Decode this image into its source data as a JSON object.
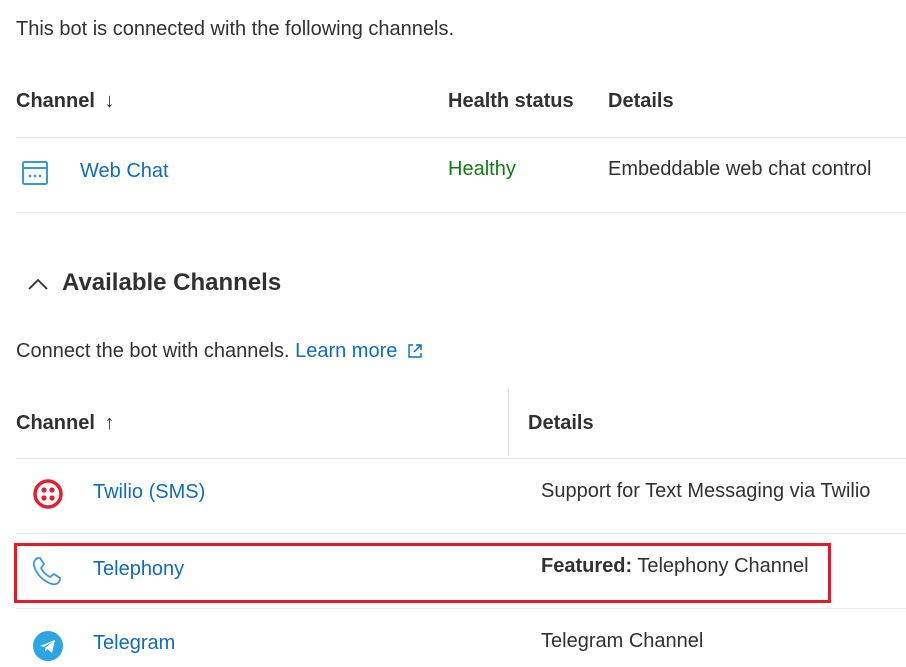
{
  "connected": {
    "intro": "This bot is connected with the following channels.",
    "columns": {
      "channel": "Channel",
      "channel_sort_icon": "↓",
      "health": "Health status",
      "details": "Details"
    },
    "rows": [
      {
        "icon": "web-chat-icon",
        "name": "Web Chat",
        "health": "Healthy",
        "details": "Embeddable web chat control"
      }
    ]
  },
  "available": {
    "title": "Available Channels",
    "collapse_icon": "chevron-up-icon",
    "intro": "Connect the bot with channels.",
    "learn_more": "Learn more",
    "columns": {
      "channel": "Channel",
      "channel_sort_icon": "↑",
      "details": "Details"
    },
    "rows": [
      {
        "icon": "twilio-icon",
        "name": "Twilio (SMS)",
        "details_bold": "",
        "details": "Support for Text Messaging via Twilio"
      },
      {
        "icon": "phone-icon",
        "name": "Telephony",
        "details_bold": "Featured:",
        "details": "Telephony Channel",
        "highlighted": true
      },
      {
        "icon": "telegram-icon",
        "name": "Telegram",
        "details_bold": "",
        "details": "Telegram Channel"
      }
    ]
  },
  "colors": {
    "link": "#0f6cbd",
    "healthy": "#107c10",
    "highlight": "#e21b2b",
    "twilio": "#e31e2d",
    "telegram": "#2ca5e0"
  }
}
